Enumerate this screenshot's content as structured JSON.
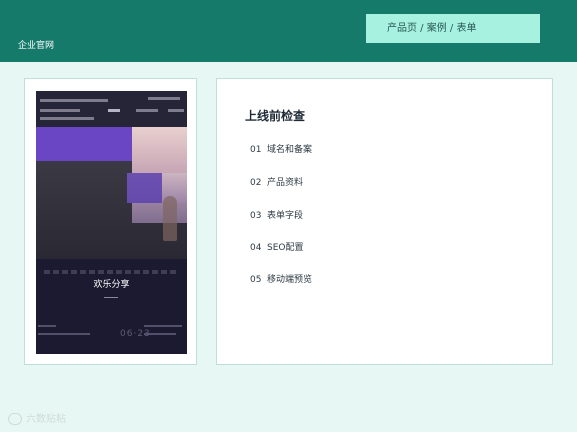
{
  "header": {
    "brand": "企业官网",
    "nav_label": "产品页 / 案例 / 表单",
    "bg_color": "#167a6b",
    "nav_bg_color": "#a6f1df"
  },
  "preview": {
    "caption": "欢乐分享",
    "date": "06·23",
    "accent_color": "#6a45c4"
  },
  "checklist": {
    "title": "上线前检查",
    "items": [
      {
        "num": "01",
        "label": "域名和备案"
      },
      {
        "num": "02",
        "label": "产品资料"
      },
      {
        "num": "03",
        "label": "表单字段"
      },
      {
        "num": "04",
        "label": "SEO配置"
      },
      {
        "num": "05",
        "label": "移动端预览"
      }
    ]
  },
  "watermark": {
    "text": "六数贴粘"
  }
}
